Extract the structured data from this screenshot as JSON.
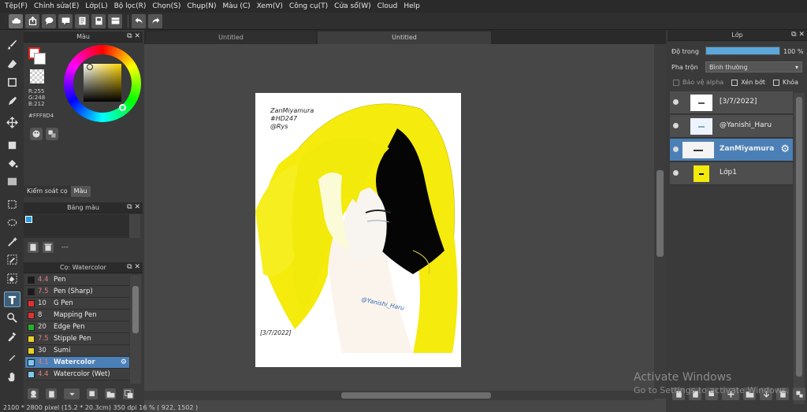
{
  "menu": [
    "Tệp(F)",
    "Chỉnh sửa(E)",
    "Lớp(L)",
    "Bộ lọc(R)",
    "Chọn(S)",
    "Chụp(N)",
    "Màu (C)",
    "Xem(V)",
    "Công cụ(T)",
    "Cửa sổ(W)",
    "Cloud",
    "Help"
  ],
  "colorPanel": {
    "title": "Màu",
    "r": "R:255",
    "g": "G:248",
    "b": "B:212",
    "hex": "#FFF8D4",
    "tabs": [
      "Kiểm soát cọ",
      "Màu"
    ]
  },
  "palettePanel": {
    "title": "Bảng màu",
    "footer": "---"
  },
  "brushPanel": {
    "title": "Cọ: Watercolor",
    "brushes": [
      {
        "size": "4.4",
        "name": "Pen",
        "color": "#1a1a1a",
        "sizeColor": "#e08080"
      },
      {
        "size": "7.5",
        "name": "Pen (Sharp)",
        "color": "#1a1a1a",
        "sizeColor": "#e08080"
      },
      {
        "size": "10",
        "name": "G Pen",
        "color": "#e03030",
        "sizeColor": "#dddddd"
      },
      {
        "size": "8",
        "name": "Mapping Pen",
        "color": "#e03030",
        "sizeColor": "#dddddd"
      },
      {
        "size": "20",
        "name": "Edge Pen",
        "color": "#27b027",
        "sizeColor": "#dddddd"
      },
      {
        "size": "7.5",
        "name": "Stipple Pen",
        "color": "#e6d22a",
        "sizeColor": "#e08080"
      },
      {
        "size": "30",
        "name": "Sumi",
        "color": "#e6d22a",
        "sizeColor": "#dddddd"
      },
      {
        "size": "4.1",
        "name": "Watercolor",
        "color": "#7fc8f0",
        "sizeColor": "#e08080",
        "selected": true
      },
      {
        "size": "4.4",
        "name": "Watercolor (Wet)",
        "color": "#7fc8f0",
        "sizeColor": "#e08080"
      }
    ]
  },
  "canvasTabs": [
    "Untitled",
    "Untitled"
  ],
  "artwork": {
    "signature": "ZanMiyamura",
    "tag": "#HD247",
    "credit": "@Rys",
    "watermark": "@Yanishi_Haru",
    "date": "[3/7/2022]"
  },
  "layerPanel": {
    "title": "Lớp",
    "opacityLabel": "Độ trong",
    "opacityValue": "100 %",
    "opacityFraction": 1.0,
    "blendLabel": "Pha trộn",
    "blendValue": "Bình thường",
    "protectAlpha": "Bảo vệ alpha",
    "clipping": "Xén bớt",
    "lock": "Khóa",
    "layers": [
      {
        "name": "[3/7/2022]",
        "selected": false
      },
      {
        "name": "@Yanishi_Haru",
        "selected": false
      },
      {
        "name": "ZanMiyamura",
        "selected": true
      },
      {
        "name": "Lớp1",
        "selected": false
      }
    ]
  },
  "status": "2100 * 2800 pixel   (15.2 * 20.3cm)   350 dpi   16 %   ( 922, 1502 )",
  "os": {
    "watermark1": "Activate Windows",
    "watermark2": "Go to Settings to activate Windows."
  },
  "colors": {
    "accent": "#4b80b7",
    "primary": "#FFF8D4",
    "hair": "#f2ea0a"
  }
}
